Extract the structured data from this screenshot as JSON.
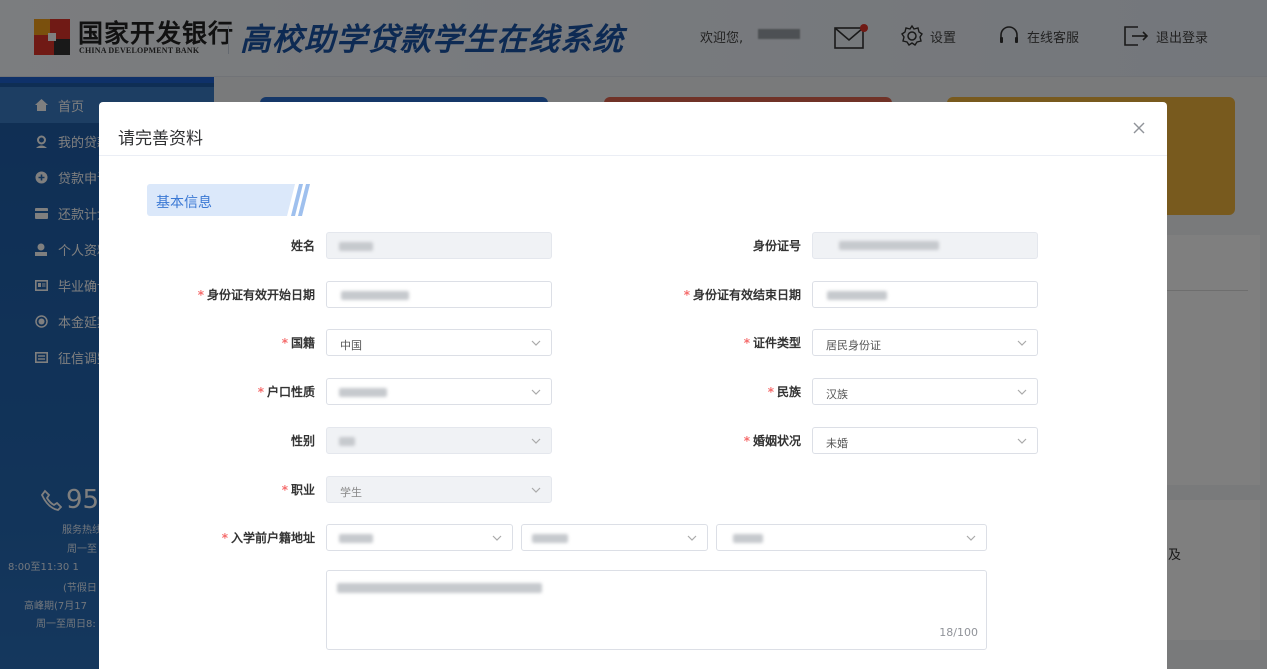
{
  "header": {
    "bank_name_cn": "国家开发银行",
    "bank_name_en": "CHINA DEVELOPMENT BANK",
    "system_title": "高校助学贷款学生在线系统",
    "greeting": "欢迎您,",
    "settings_label": "设置",
    "service_label": "在线客服",
    "logout_label": "退出登录"
  },
  "sidebar": {
    "items": [
      {
        "label": "首页",
        "icon": "home-icon"
      },
      {
        "label": "我的贷款",
        "icon": "user-badge-icon"
      },
      {
        "label": "贷款申请",
        "icon": "plus-circle-icon"
      },
      {
        "label": "还款计划",
        "icon": "card-icon"
      },
      {
        "label": "个人资料",
        "icon": "person-icon"
      },
      {
        "label": "毕业确认",
        "icon": "id-card-icon"
      },
      {
        "label": "本金延期",
        "icon": "radio-icon"
      },
      {
        "label": "征信调整",
        "icon": "report-icon"
      }
    ],
    "hotline": {
      "number": "95",
      "line1": "服务热线",
      "line2": "周一至",
      "line3": "8:00至11:30 1",
      "line4": "(节假日",
      "line5": "高峰期(7月17",
      "line6": "周一至周日8:"
    }
  },
  "background": {
    "panel_text": "及"
  },
  "dialog": {
    "title": "请完善资料",
    "section": "基本信息",
    "labels": {
      "name": "姓名",
      "id_number": "身份证号",
      "id_start": "身份证有效开始日期",
      "id_end": "身份证有效结束日期",
      "nationality": "国籍",
      "cert_type": "证件类型",
      "hukou_type": "户口性质",
      "ethnicity": "民族",
      "gender": "性别",
      "marital": "婚姻状况",
      "occupation": "职业",
      "address": "入学前户籍地址"
    },
    "required_mark": "*",
    "values": {
      "nationality": "中国",
      "cert_type": "居民身份证",
      "ethnicity": "汉族",
      "marital": "未婚",
      "occupation": "学生"
    },
    "textarea_counter": "18/100"
  },
  "colors": {
    "primary": "#1a54a6",
    "sidebar": "#2468b3",
    "required": "#f56c6c",
    "section_bg": "#dbe8fa"
  }
}
